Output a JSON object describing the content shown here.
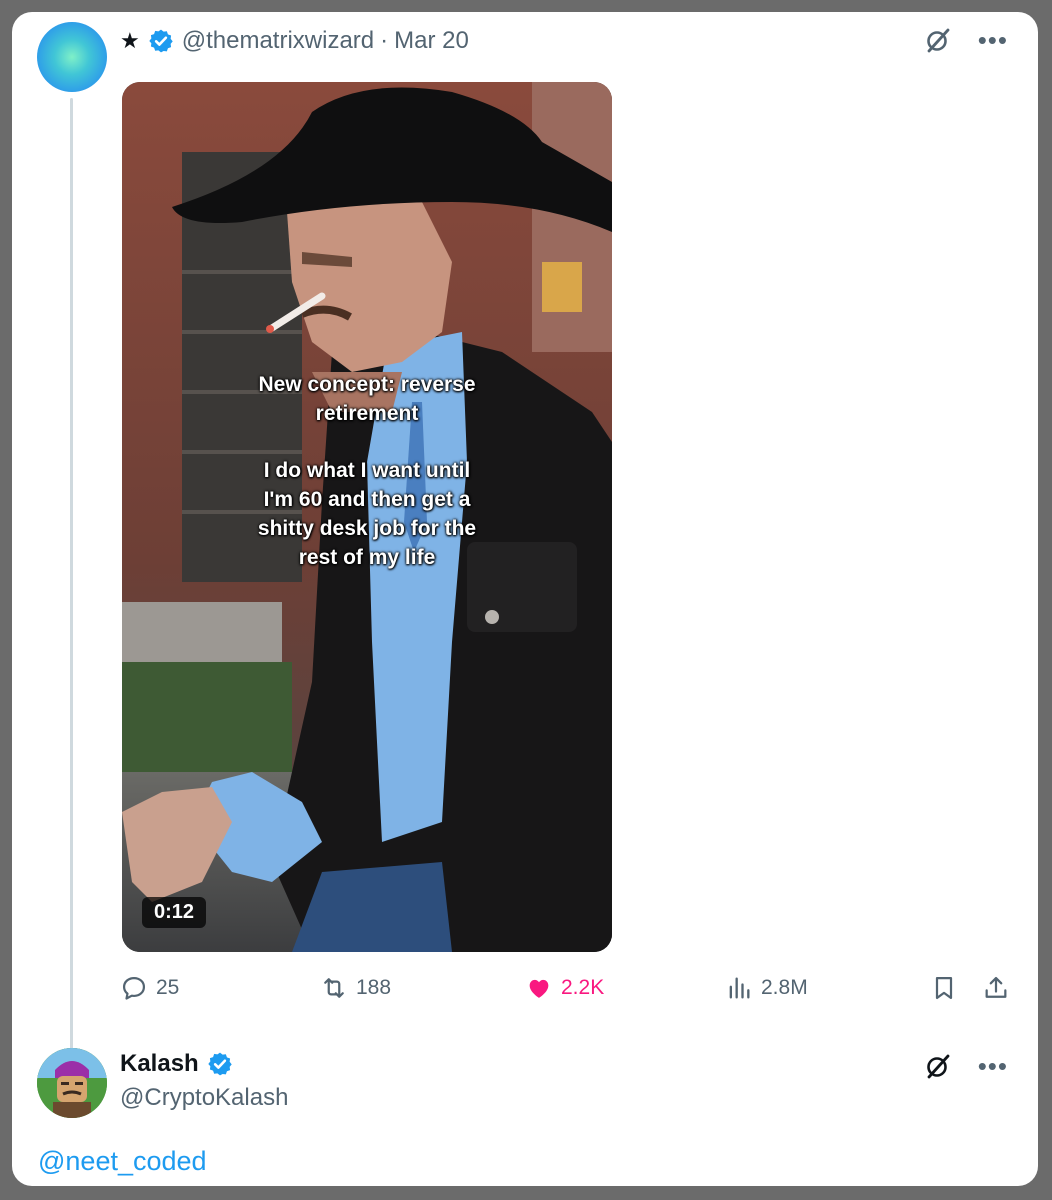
{
  "post": {
    "star": "★",
    "handle": "@thematrixwizard",
    "separator": "·",
    "date": "Mar 20",
    "media": {
      "caption_line1": "New concept: reverse",
      "caption_line2": "retirement",
      "caption_body": [
        "I do what I want until",
        "I'm 60 and then get a",
        "shitty desk job for the",
        "rest of my life"
      ],
      "duration": "0:12"
    },
    "actions": {
      "replies": "25",
      "reposts": "188",
      "likes": "2.2K",
      "views": "2.8M"
    },
    "colors": {
      "like": "#f91880",
      "verified": "#1d9bf0",
      "link": "#1d9bf0"
    }
  },
  "reply": {
    "name": "Kalash",
    "handle": "@CryptoKalash",
    "text": "@neet_coded"
  },
  "icons": [
    "star-icon",
    "verified-badge-icon",
    "grok-icon",
    "more-icon",
    "reply-icon",
    "repost-icon",
    "like-icon",
    "views-icon",
    "bookmark-icon",
    "share-icon"
  ]
}
